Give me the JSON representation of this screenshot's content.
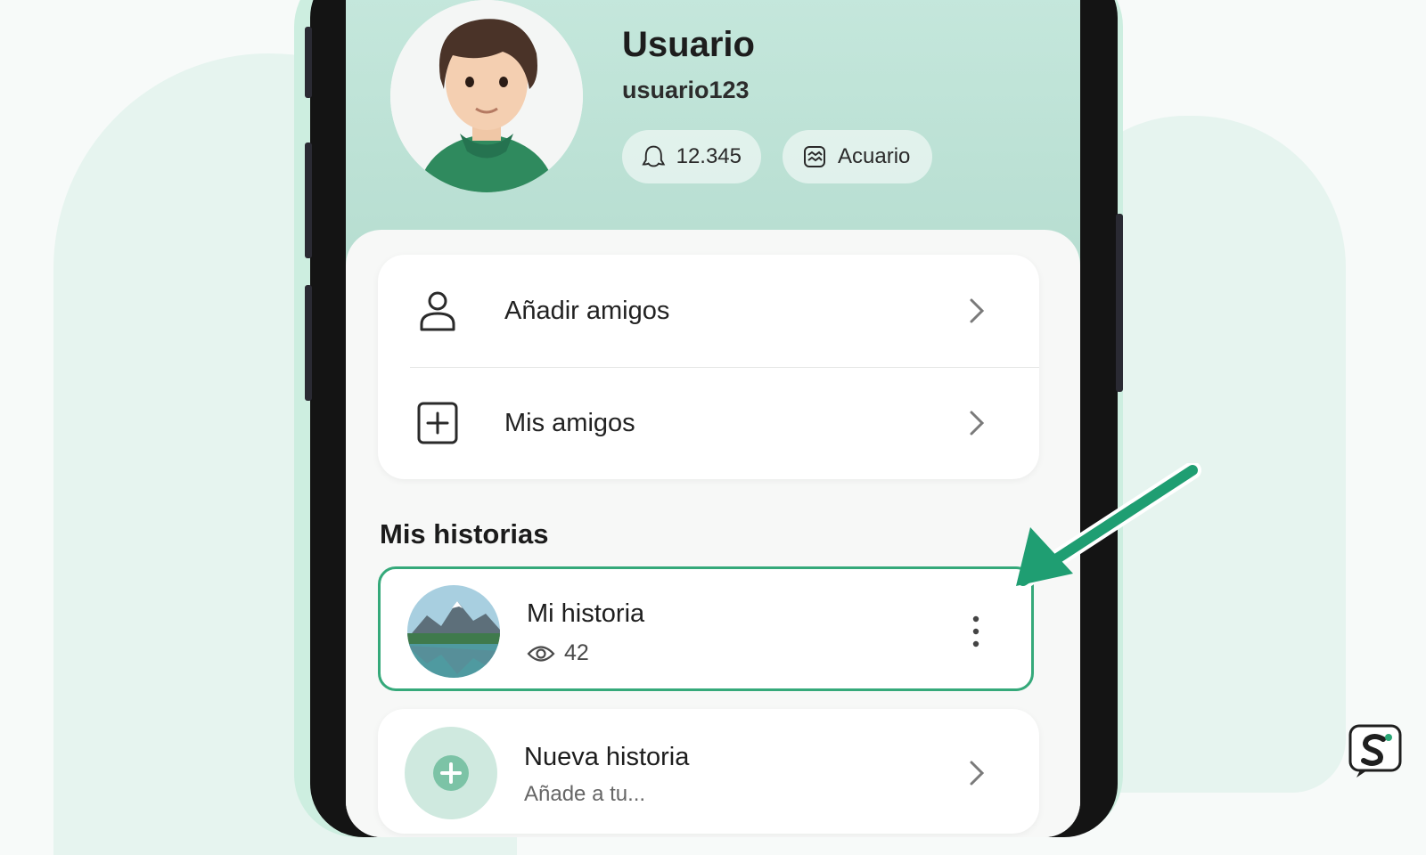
{
  "profile": {
    "display_name": "Usuario",
    "username": "usuario123",
    "score": "12.345",
    "zodiac": "Acuario"
  },
  "menu": {
    "items": [
      {
        "label": "Añadir amigos",
        "icon": "person-icon"
      },
      {
        "label": "Mis amigos",
        "icon": "plus-square-icon"
      }
    ]
  },
  "stories": {
    "section_title": "Mis historias",
    "items": [
      {
        "title": "Mi historia",
        "views": "42"
      },
      {
        "title": "Nueva historia",
        "subtitle": "Añade a tu..."
      }
    ]
  },
  "colors": {
    "accent": "#2aa676",
    "header_bg": "#bfe4d8",
    "background": "#f7faf9"
  }
}
